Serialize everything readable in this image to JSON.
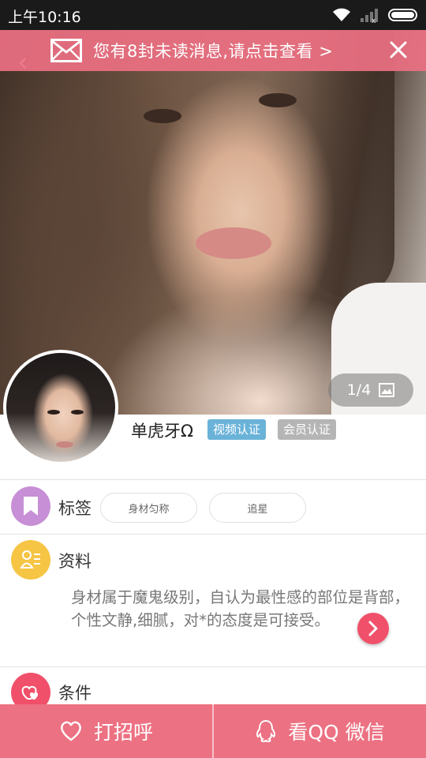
{
  "status_bar": {
    "time": "上午10:16"
  },
  "banner": {
    "text": "您有8封未读消息,请点击查看 >"
  },
  "photo": {
    "counter": "1/4"
  },
  "profile": {
    "name": "单虎牙Ω",
    "badges": {
      "video": "视频认证",
      "member": "会员认证"
    }
  },
  "tags_section": {
    "title": "标签",
    "items": [
      "身材匀称",
      "追星"
    ]
  },
  "info_section": {
    "title": "资料",
    "bio": "身材属于魔鬼级别，自认为最性感的部位是背部，个性文静,细腻，对*的态度是可接受。"
  },
  "conditions_section": {
    "title": "条件"
  },
  "bottom_bar": {
    "greet_label": "打招呼",
    "contact_label": "看QQ 微信"
  },
  "colors": {
    "accent": "#ec7182",
    "tag_icon": "#c78fd6",
    "info_icon": "#f6c544",
    "condition_icon": "#f0506a"
  }
}
